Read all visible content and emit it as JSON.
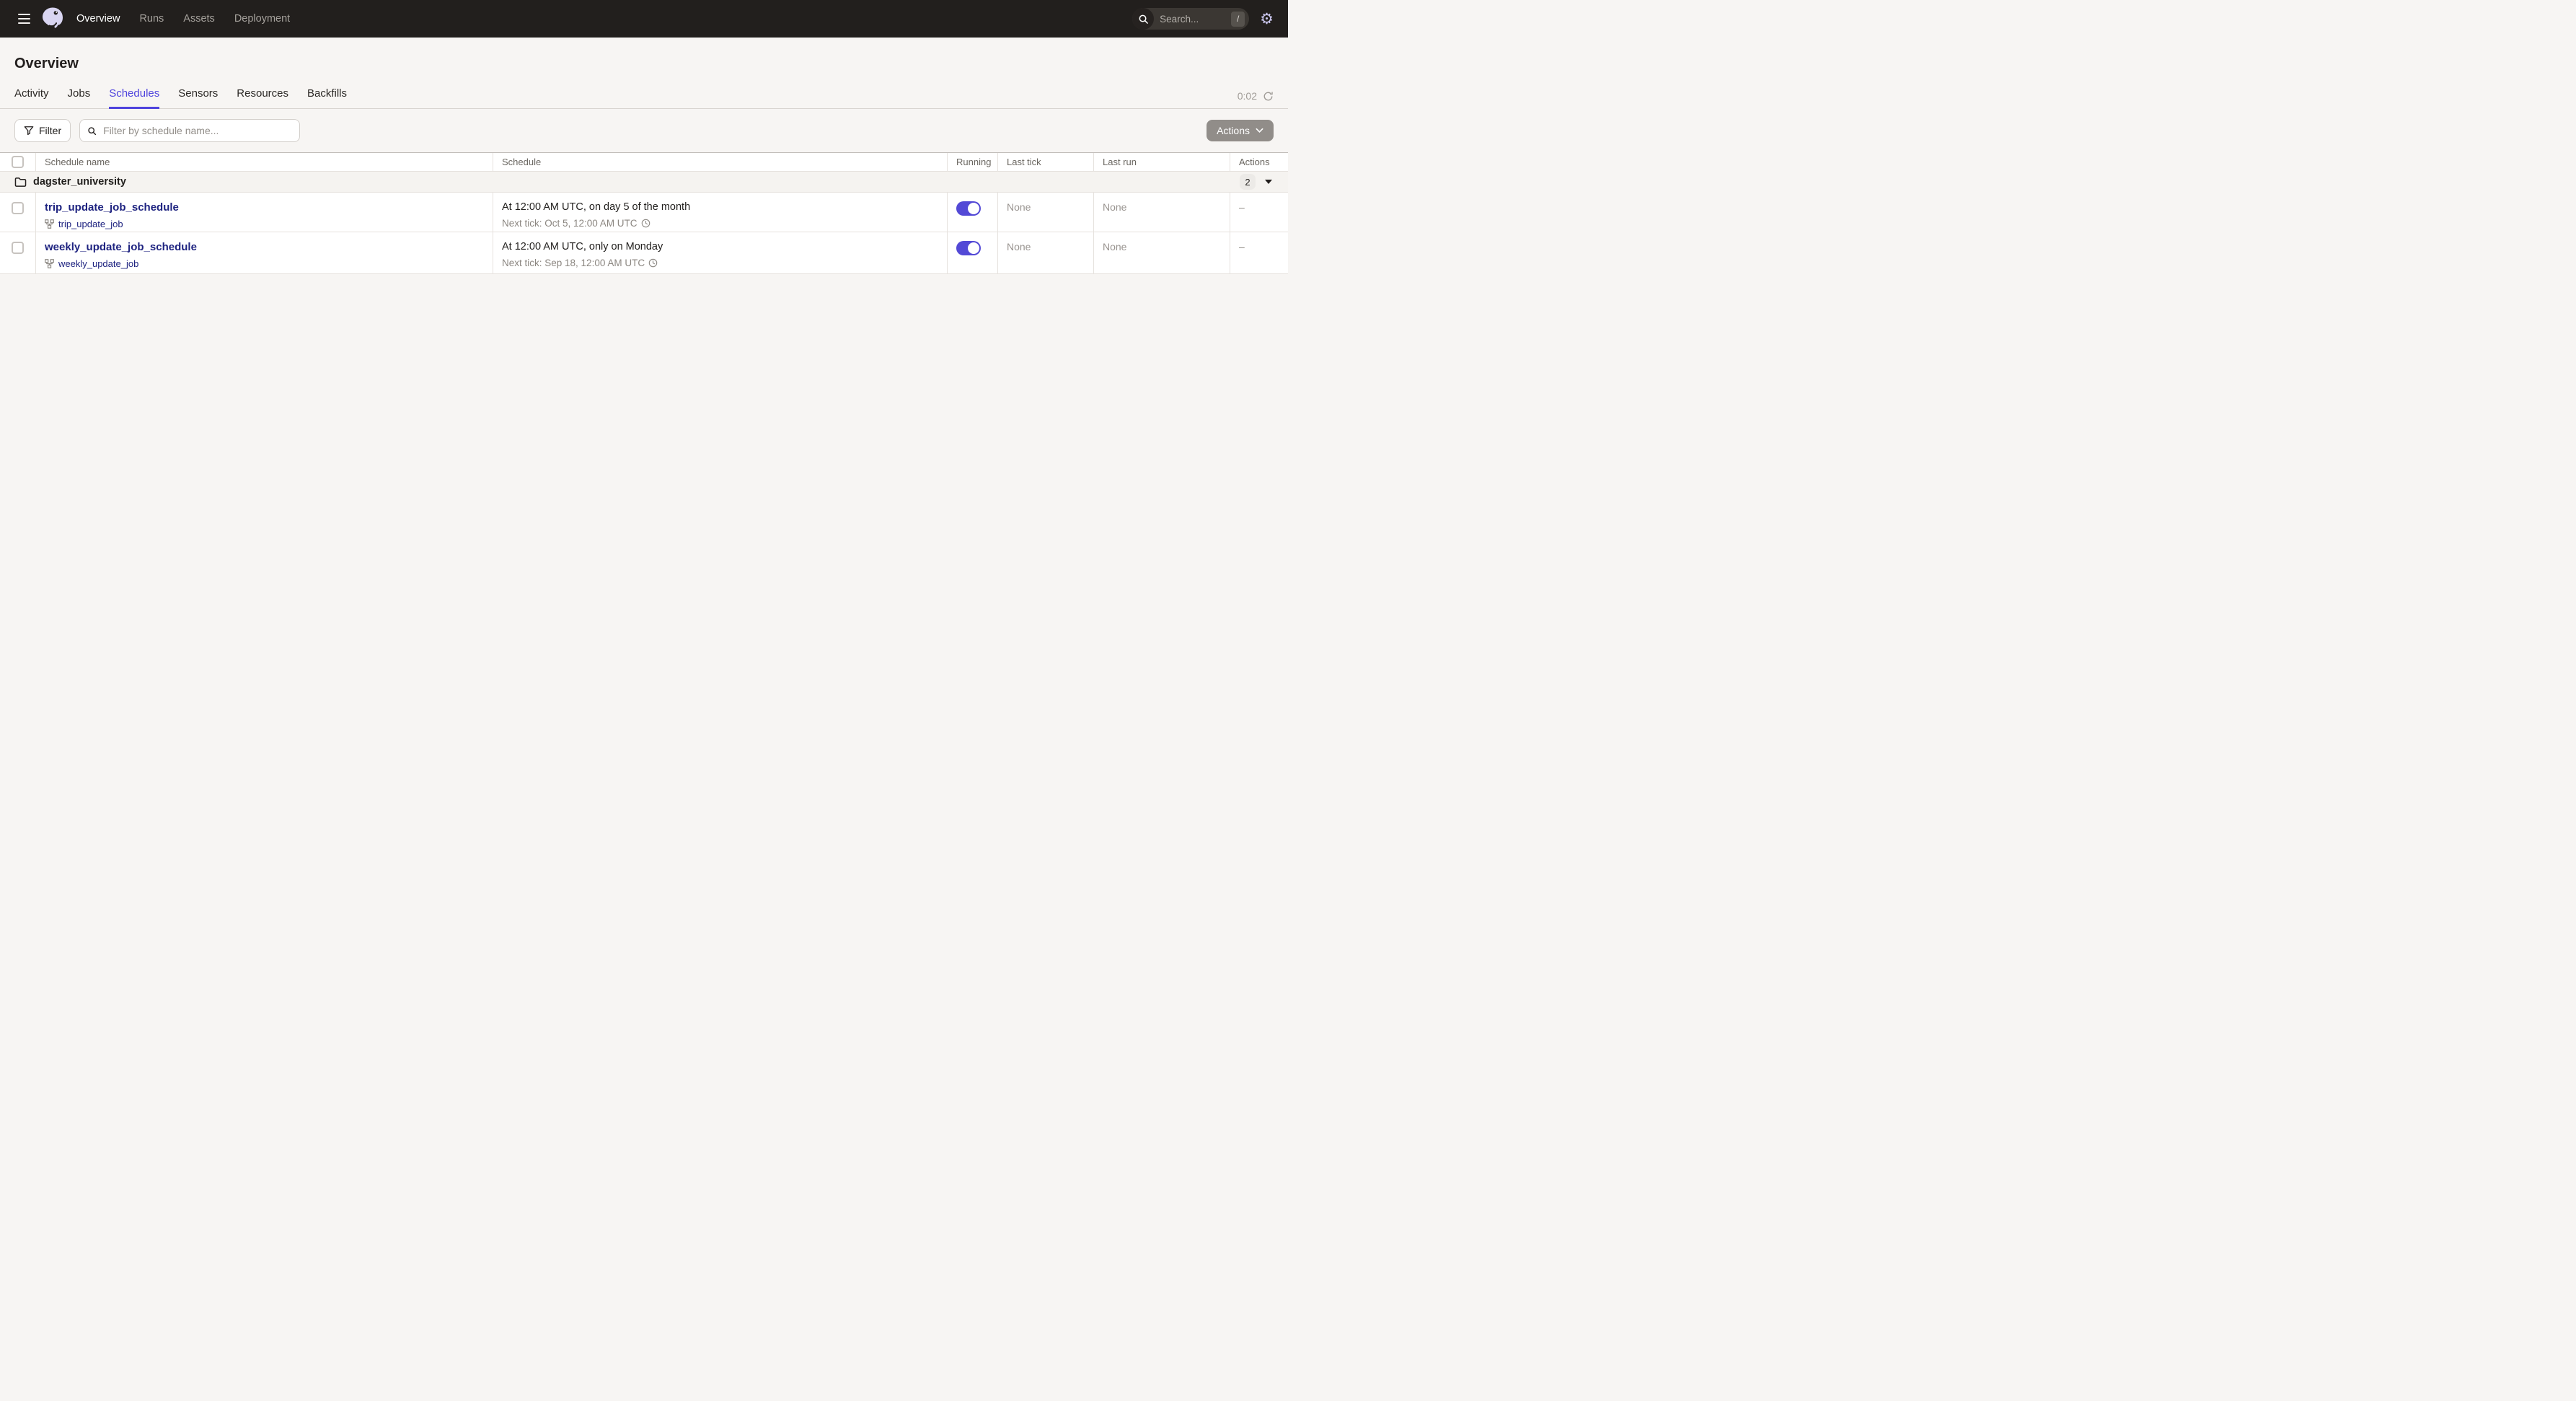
{
  "nav": {
    "items": [
      {
        "label": "Overview",
        "active": true
      },
      {
        "label": "Runs",
        "active": false
      },
      {
        "label": "Assets",
        "active": false
      },
      {
        "label": "Deployment",
        "active": false
      }
    ],
    "search": {
      "placeholder": "Search...",
      "shortcut": "/"
    }
  },
  "page": {
    "title": "Overview"
  },
  "tabs": {
    "items": [
      {
        "label": "Activity",
        "active": false
      },
      {
        "label": "Jobs",
        "active": false
      },
      {
        "label": "Schedules",
        "active": true
      },
      {
        "label": "Sensors",
        "active": false
      },
      {
        "label": "Resources",
        "active": false
      },
      {
        "label": "Backfills",
        "active": false
      }
    ],
    "refresh_timer": "0:02"
  },
  "toolbar": {
    "filter_label": "Filter",
    "filter_placeholder": "Filter by schedule name...",
    "actions_label": "Actions"
  },
  "table": {
    "columns": [
      "Schedule name",
      "Schedule",
      "Running",
      "Last tick",
      "Last run",
      "Actions"
    ],
    "group": {
      "name": "dagster_university",
      "count": "2"
    },
    "rows": [
      {
        "name": "trip_update_job_schedule",
        "job": "trip_update_job",
        "schedule": "At 12:00 AM UTC, on day 5 of the month",
        "next_tick": "Next tick: Oct 5, 12:00 AM UTC",
        "running": true,
        "last_tick": "None",
        "last_run": "None",
        "actions": "–"
      },
      {
        "name": "weekly_update_job_schedule",
        "job": "weekly_update_job",
        "schedule": "At 12:00 AM UTC, only on Monday",
        "next_tick": "Next tick: Sep 18, 12:00 AM UTC",
        "running": true,
        "last_tick": "None",
        "last_run": "None",
        "actions": "–"
      }
    ]
  },
  "colors": {
    "nav_bg": "#221f1d",
    "page_bg": "#f7f5f3",
    "accent": "#4f43dd",
    "toggle_on": "#5349d6",
    "link": "#1e2380",
    "muted_text": "#999490"
  }
}
